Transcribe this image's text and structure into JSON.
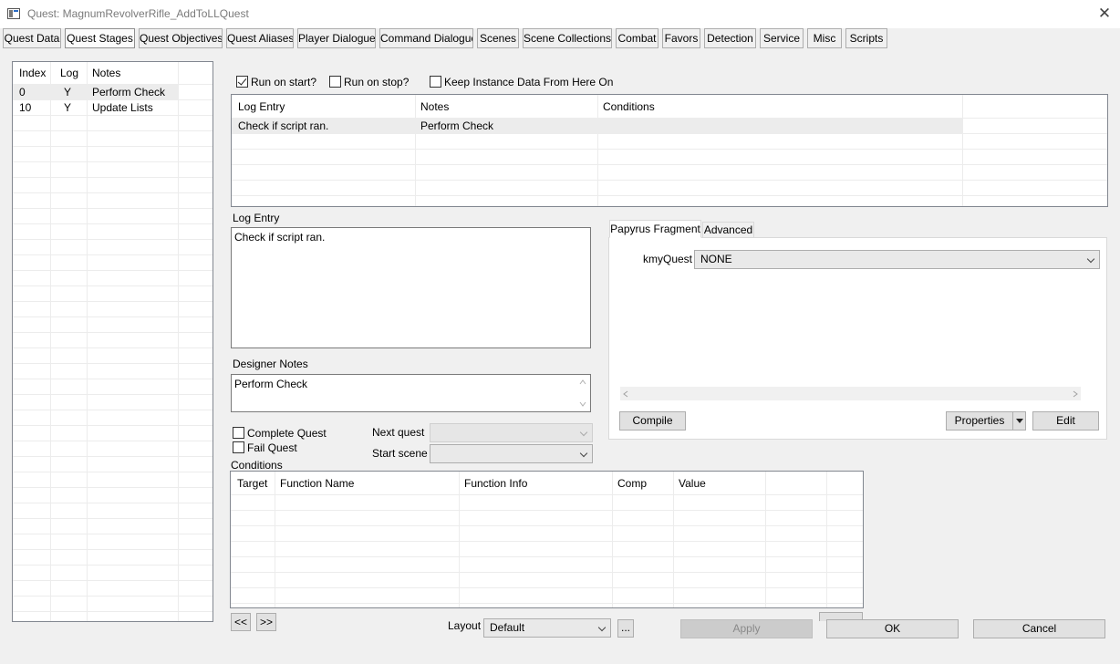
{
  "window": {
    "title": "Quest: MagnumRevolverRifle_AddToLLQuest",
    "app_icon": "window-icon",
    "close_icon": "close-icon",
    "close_glyph": "✕"
  },
  "tabs": [
    {
      "label": "Quest Data"
    },
    {
      "label": "Quest Stages",
      "active": true
    },
    {
      "label": "Quest Objectives"
    },
    {
      "label": "Quest Aliases"
    },
    {
      "label": "Player Dialogue"
    },
    {
      "label": "Command Dialogue"
    },
    {
      "label": "Scenes"
    },
    {
      "label": "Scene Collections"
    },
    {
      "label": "Combat"
    },
    {
      "label": "Favors"
    },
    {
      "label": "Detection"
    },
    {
      "label": "Service"
    },
    {
      "label": "Misc"
    },
    {
      "label": "Scripts"
    }
  ],
  "stages": {
    "columns": [
      "Index",
      "Log",
      "Notes"
    ],
    "rows": [
      {
        "index": "0",
        "log": "Y",
        "notes": "Perform Check"
      },
      {
        "index": "10",
        "log": "Y",
        "notes": "Update Lists"
      }
    ]
  },
  "options": {
    "run_on_start": "Run on start?",
    "run_on_start_checked": true,
    "run_on_stop": "Run on stop?",
    "keep_instance": "Keep Instance Data From Here On"
  },
  "log_entries": {
    "columns": [
      "Log Entry",
      "Notes",
      "Conditions"
    ],
    "rows": [
      {
        "log_entry": "Check if script ran.",
        "notes": "Perform Check",
        "conditions": ""
      }
    ]
  },
  "log_entry": {
    "label": "Log Entry",
    "value": "Check if script ran."
  },
  "designer_notes": {
    "label": "Designer Notes",
    "value": "Perform Check"
  },
  "complete_quest": "Complete Quest",
  "fail_quest": "Fail Quest",
  "next_quest": {
    "label": "Next quest",
    "value": ""
  },
  "start_scene": {
    "label": "Start scene",
    "value": ""
  },
  "fragment": {
    "tabs": [
      "Papyrus Fragment",
      "Advanced"
    ],
    "property_label": "kmyQuest",
    "property_value": "NONE",
    "compile": "Compile",
    "properties": "Properties",
    "edit": "Edit"
  },
  "conditions": {
    "label": "Conditions",
    "columns": [
      "Target",
      "Function Name",
      "Function Info",
      "Comp",
      "Value"
    ]
  },
  "nav": {
    "prev": "<<",
    "next": ">>"
  },
  "layout": {
    "label": "Layout",
    "value": "Default",
    "more": "..."
  },
  "footer": {
    "apply": "Apply",
    "ok": "OK",
    "cancel": "Cancel"
  }
}
